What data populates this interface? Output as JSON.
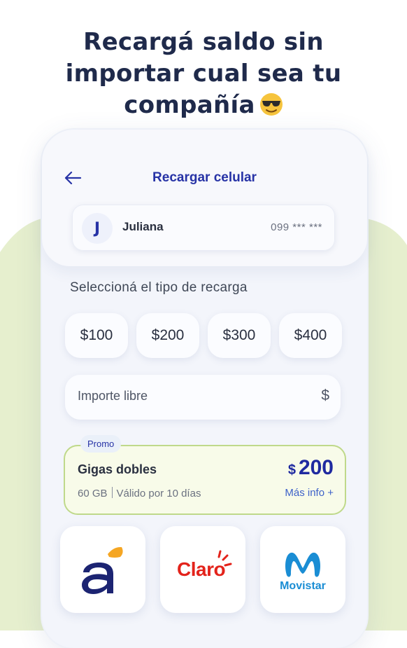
{
  "headline": {
    "line1": "Recargá saldo sin",
    "line2": "importar cual sea tu",
    "line3": "compañía"
  },
  "screen": {
    "title": "Recargar celular",
    "back_icon": "arrow-left-icon"
  },
  "contact": {
    "initial": "J",
    "name": "Juliana",
    "phone": "099 *** ***"
  },
  "recharge": {
    "section_label": "Seleccioná el tipo de recarga",
    "amounts": [
      "$100",
      "$200",
      "$300",
      "$400"
    ],
    "free_amount_placeholder": "Importe libre",
    "currency_symbol": "$"
  },
  "promo": {
    "tag": "Promo",
    "title": "Gigas dobles",
    "data": "60 GB",
    "validity": "Válido por 10 días",
    "price_symbol": "$",
    "price_value": "200",
    "more_info": "Más info +"
  },
  "carriers": [
    {
      "name": "Antel",
      "icon": "antel-logo"
    },
    {
      "name": "Claro",
      "label": "Claro"
    },
    {
      "name": "Movistar",
      "label": "Movistar"
    }
  ],
  "colors": {
    "primary": "#2733a6",
    "promo_border": "#bfd98a",
    "background_accent": "#e6efce",
    "claro_red": "#e3231b",
    "movistar_blue": "#1a8dd4",
    "antel_navy": "#1c2472",
    "antel_orange": "#f5a623"
  }
}
